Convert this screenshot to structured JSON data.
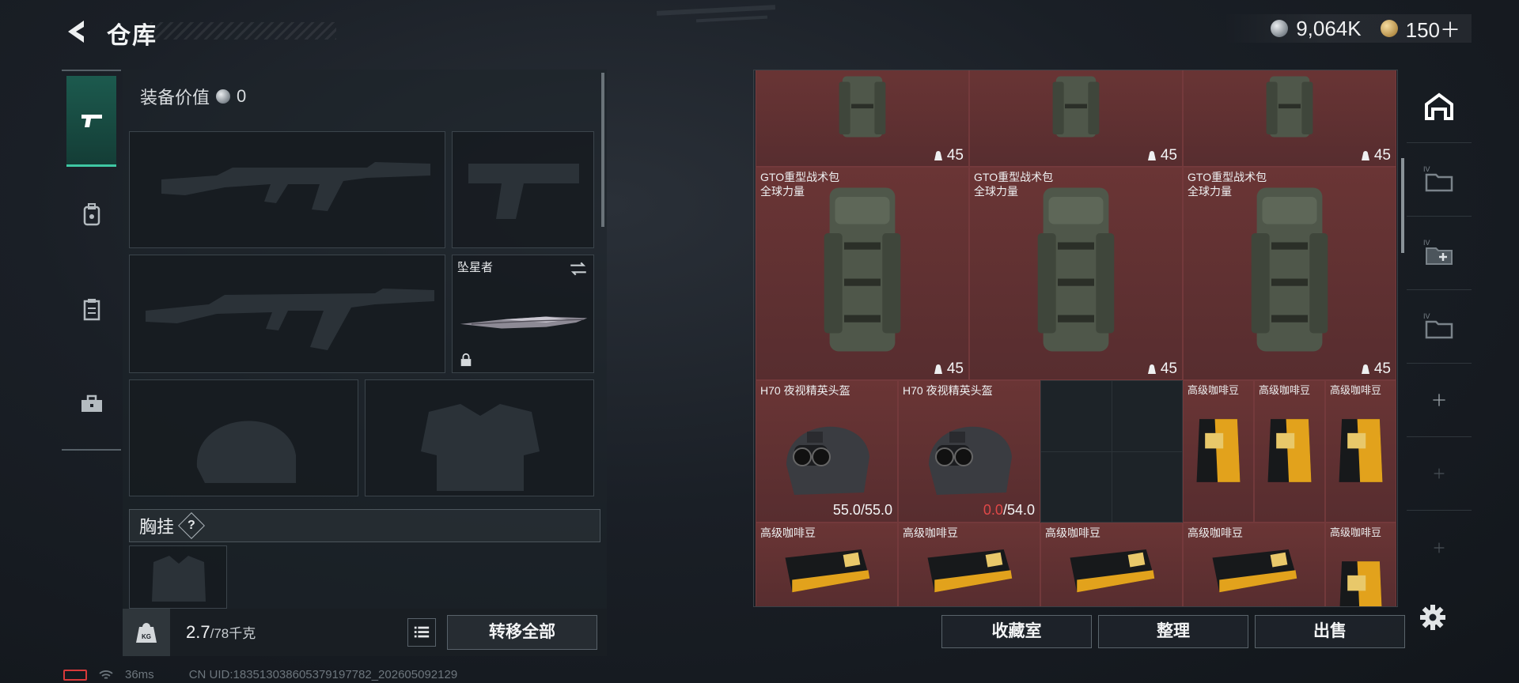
{
  "header": {
    "title": "仓库"
  },
  "currency": [
    {
      "icon": "silver-coin-icon",
      "value": "9,064K"
    },
    {
      "icon": "gold-coin-icon",
      "value": "150＋"
    }
  ],
  "left_nav": [
    {
      "icon": "pistol-icon",
      "active": true
    },
    {
      "icon": "backpack-tag-icon",
      "active": false
    },
    {
      "icon": "clipboard-icon",
      "active": false
    },
    {
      "icon": "toolbox-icon",
      "active": false
    }
  ],
  "loadout": {
    "equip_value_label": "装备价值",
    "equip_value": "0",
    "melee_slot_name": "坠星者",
    "chest_rig_label": "胸挂",
    "chest_rig_help": "?"
  },
  "weight": {
    "current": "2.7",
    "max": "/78千克"
  },
  "transfer_all_label": "转移全部",
  "inventory": {
    "rows": [
      {
        "name": "",
        "count": "45"
      },
      {
        "name": "GTO重型战术包\n全球力量",
        "count": "45"
      },
      {
        "name": "H70 夜视精英头盔",
        "durability": [
          "55.0",
          "/55.0",
          "0.0",
          "/54.0"
        ]
      },
      {
        "name": "高级咖啡豆"
      }
    ],
    "backpack_name_line1": "GTO重型战术包",
    "backpack_name_line2": "全球力量",
    "helmet_name": "H70 夜视精英头盔",
    "helmet1_durability_cur": "55.0",
    "helmet1_durability_max": "/55.0",
    "helmet2_durability_cur": "0.0",
    "helmet2_durability_max": "/54.0",
    "coffee_name": "高级咖啡豆",
    "stack_count": "45"
  },
  "actions": {
    "collection": "收藏室",
    "sort": "整理",
    "sell": "出售"
  },
  "status": {
    "ping": "36ms",
    "uid": "CN UID:183513038605379197782_202605092129"
  },
  "colors": {
    "accent": "#3fc7a3",
    "item_bg": "#5f3132",
    "danger": "#e04848"
  }
}
